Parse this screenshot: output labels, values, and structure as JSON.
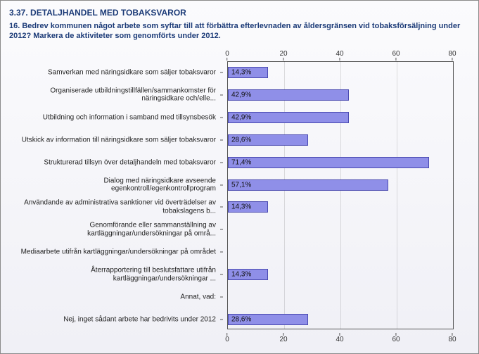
{
  "section_title": "3.37. DETALJHANDEL MED TOBAKSVAROR",
  "question_text": "16. Bedrev kommunen något arbete som syftar till att förbättra efterlevnaden av åldersgränsen vid tobaksförsäljning under 2012? Markera de aktiviteter som genomförts under 2012.",
  "chart_data": {
    "type": "bar",
    "orientation": "horizontal",
    "xlabel": "",
    "ylabel": "",
    "xlim": [
      0,
      80
    ],
    "x_ticks": [
      0,
      20,
      40,
      60,
      80
    ],
    "unit": "%",
    "categories": [
      "Samverkan med näringsidkare som säljer tobaksvaror",
      "Organiserade utbildningstillfällen/sammankomster för näringsidkare och/elle...",
      "Utbildning och information i samband med tillsynsbesök",
      "Utskick av information till näringsidkare som säljer tobaksvaror",
      "Strukturerad tillsyn över detaljhandeln med tobaksvaror",
      "Dialog med näringsidkare avseende egenkontroll/egenkontrollprogram",
      "Användande av administrativa sanktioner vid överträdelser av tobakslagens b...",
      "Genomförande eller sammanställning av kartläggningar/undersökningar på områ...",
      "Mediaarbete utifrån kartläggningar/undersökningar på området",
      "Återrapportering till beslutsfattare utifrån kartläggningar/undersökningar ...",
      "Annat, vad:",
      "Nej, inget sådant arbete har bedrivits under 2012"
    ],
    "values": [
      14.3,
      42.9,
      42.9,
      28.6,
      71.4,
      57.1,
      14.3,
      0,
      0,
      14.3,
      0,
      28.6
    ],
    "value_labels": [
      "14,3%",
      "42,9%",
      "42,9%",
      "28,6%",
      "71,4%",
      "57,1%",
      "14,3%",
      "",
      "",
      "14,3%",
      "",
      "28,6%"
    ],
    "bar_color": "#8f8fe8",
    "bar_border": "#4a4ab0"
  }
}
